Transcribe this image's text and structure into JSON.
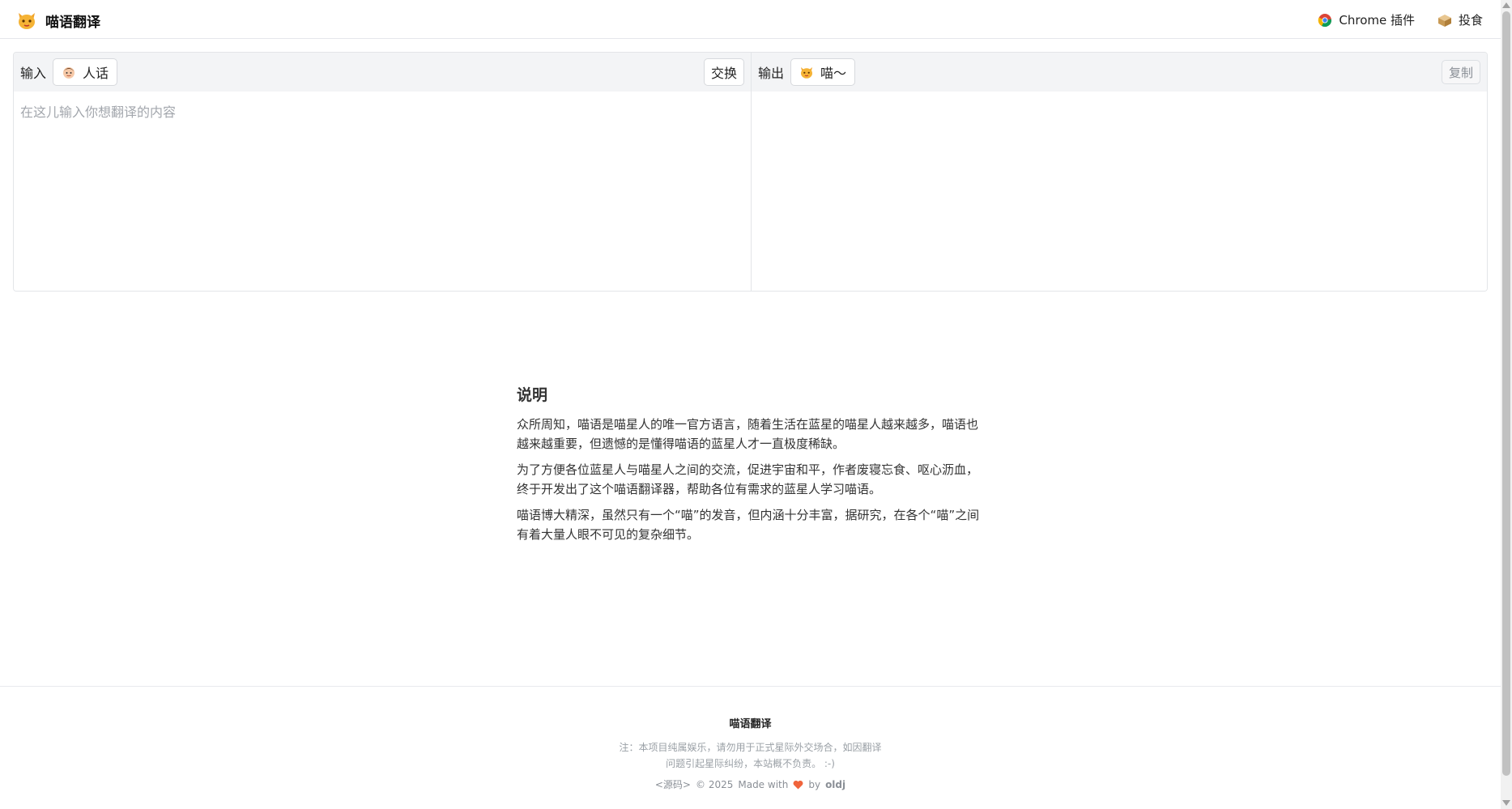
{
  "header": {
    "brand_title": "喵语翻译",
    "brand_icon": "cat-face-icon",
    "nav": [
      {
        "label": "Chrome 插件",
        "icon": "chrome-icon"
      },
      {
        "label": "投食",
        "icon": "food-box-icon"
      }
    ]
  },
  "translator": {
    "input": {
      "label": "输入",
      "lang_label": "人话",
      "lang_icon": "person-face-icon",
      "placeholder": "在这儿输入你想翻译的内容",
      "value": "",
      "swap_label": "交换"
    },
    "output": {
      "label": "输出",
      "lang_label": "喵～",
      "lang_icon": "cat-face-icon",
      "copy_label": "复制",
      "value": ""
    }
  },
  "description": {
    "title": "说明",
    "paragraphs": [
      "众所周知，喵语是喵星人的唯一官方语言，随着生活在蓝星的喵星人越来越多，喵语也越来越重要，但遗憾的是懂得喵语的蓝星人才一直极度稀缺。",
      "为了方便各位蓝星人与喵星人之间的交流，促进宇宙和平，作者废寝忘食、呕心沥血，终于开发出了这个喵语翻译器，帮助各位有需求的蓝星人学习喵语。",
      "喵语博大精深，虽然只有一个“喵”的发音，但内涵十分丰富，据研究，在各个“喵”之间有着大量人眼不可见的复杂细节。"
    ]
  },
  "footer": {
    "title": "喵语翻译",
    "note": "注：本项目纯属娱乐，请勿用于正式星际外交场合，如因翻译问题引起星际纠纷，本站概不负责。 :-)",
    "source_link": "<源码>",
    "copyright": "© 2025",
    "made_with": "Made with",
    "by": "by",
    "author": "oldj"
  },
  "colors": {
    "accent_orange": "#f5a623",
    "heart": "#f0643c",
    "muted_text": "#9aa0a6"
  }
}
